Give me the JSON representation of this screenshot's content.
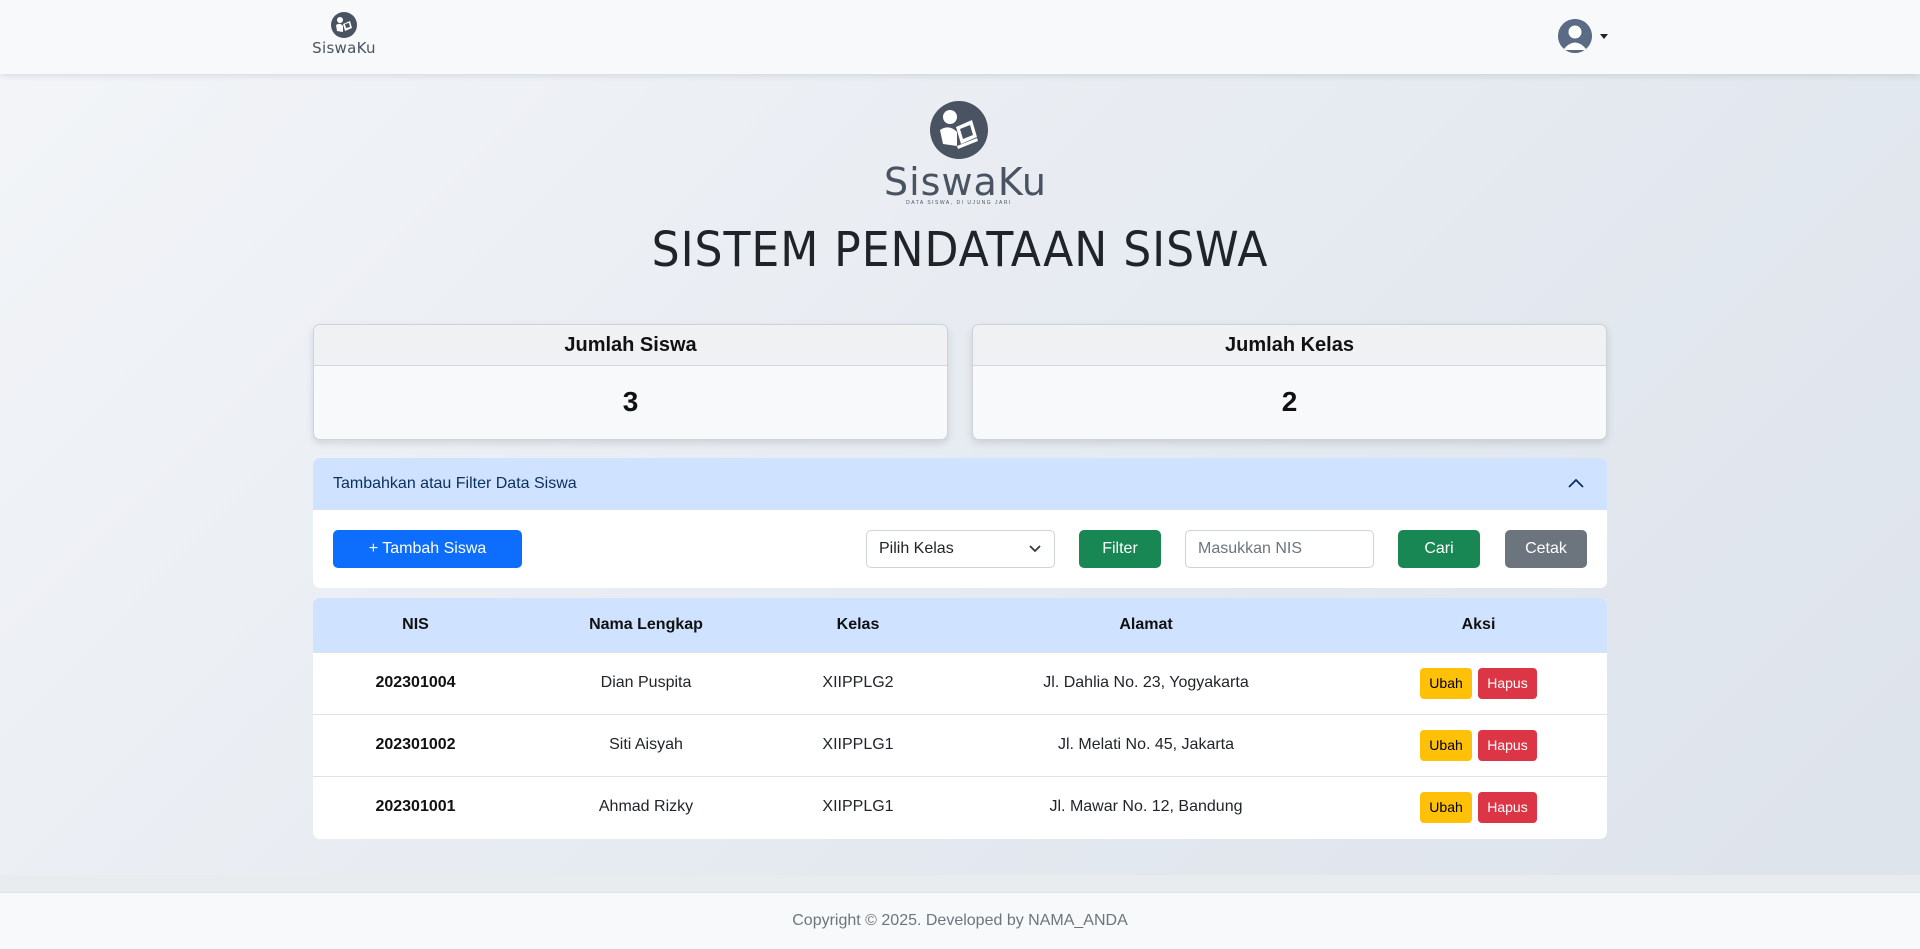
{
  "navbar": {
    "brand": "SiswaKu",
    "user_icon": "user-avatar-icon",
    "menu_icon": "caret-down-icon"
  },
  "hero": {
    "logo_text": "SiswaKu",
    "tagline": "DATA SISWA, DI UJUNG JARI",
    "title": "SISTEM PENDATAAN SISWA"
  },
  "stats": {
    "students_label": "Jumlah Siswa",
    "students_value": "3",
    "classes_label": "Jumlah Kelas",
    "classes_value": "2"
  },
  "filter": {
    "title": "Tambahkan atau Filter Data Siswa",
    "collapse_icon": "chevron-up-icon",
    "add_label": "+ Tambah Siswa",
    "class_select_value": "Pilih Kelas",
    "filter_label": "Filter",
    "nis_placeholder": "Masukkan NIS",
    "search_label": "Cari",
    "print_label": "Cetak"
  },
  "table": {
    "headers": [
      "NIS",
      "Nama Lengkap",
      "Kelas",
      "Alamat",
      "Aksi"
    ],
    "rows": [
      {
        "nis": "202301004",
        "nama": "Dian Puspita",
        "kelas": "XIIPPLG2",
        "alamat": "Jl. Dahlia No. 23, Yogyakarta",
        "edit": "Ubah",
        "delete": "Hapus"
      },
      {
        "nis": "202301002",
        "nama": "Siti Aisyah",
        "kelas": "XIIPPLG1",
        "alamat": "Jl. Melati No. 45, Jakarta",
        "edit": "Ubah",
        "delete": "Hapus"
      },
      {
        "nis": "202301001",
        "nama": "Ahmad Rizky",
        "kelas": "XIIPPLG1",
        "alamat": "Jl. Mawar No. 12, Bandung",
        "edit": "Ubah",
        "delete": "Hapus"
      }
    ]
  },
  "footer": {
    "text": "Copyright © 2025. Developed by NAMA_ANDA"
  },
  "colors": {
    "primary": "#0d6efd",
    "success": "#198754",
    "secondary": "#6c757d",
    "warning": "#ffc107",
    "danger": "#dc3545",
    "accent_light": "#cfe2ff"
  }
}
